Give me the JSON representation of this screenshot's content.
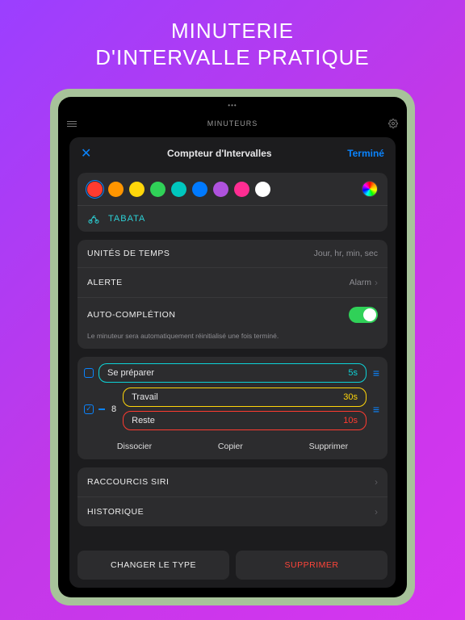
{
  "promo": {
    "line1": "MINUTERIE",
    "line2": "D'INTERVALLE PRATIQUE"
  },
  "nav": {
    "title": "MINUTEURS"
  },
  "modal": {
    "close": "✕",
    "title": "Compteur d'Intervalles",
    "done": "Terminé"
  },
  "colors": {
    "palette": [
      "#ff3b30",
      "#ff9500",
      "#ffd60a",
      "#30d158",
      "#00c7be",
      "#007aff",
      "#af52de",
      "#ff2d92",
      "#ffffff"
    ],
    "preset_name": "TABATA"
  },
  "settings": {
    "units": {
      "label": "UNITÉS DE TEMPS",
      "value": "Jour, hr, min, sec"
    },
    "alert": {
      "label": "ALERTE",
      "value": "Alarm"
    },
    "auto": {
      "label": "AUTO-COMPLÉTION",
      "desc": "Le minuteur sera automatiquement réinitialisé une fois terminé."
    }
  },
  "intervals": {
    "prep": {
      "name": "Se préparer",
      "dur": "5s"
    },
    "group_count": "8",
    "work": {
      "name": "Travail",
      "dur": "30s"
    },
    "rest": {
      "name": "Reste",
      "dur": "10s"
    },
    "actions": {
      "ungroup": "Dissocier",
      "copy": "Copier",
      "delete": "Supprimer"
    }
  },
  "links": {
    "siri": "RACCOURCIS SIRI",
    "history": "HISTORIQUE"
  },
  "buttons": {
    "change": "CHANGER LE TYPE",
    "delete": "SUPPRIMER"
  }
}
